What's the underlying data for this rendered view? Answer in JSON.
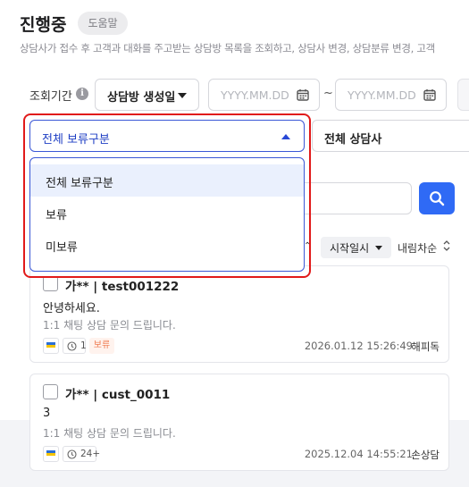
{
  "page": {
    "title": "진행중",
    "help_label": "도움말",
    "description": "상담사가 접수 후 고객과 대화를 주고받는 상담방 목록을 조회하고, 상담사 변경, 상담분류 변경, 고객"
  },
  "filters": {
    "period_label": "조회기간",
    "date_type": "상담방 생성일",
    "start_placeholder": "YYYY.MM.DD",
    "range_separator": "~",
    "end_placeholder": "YYYY.MM.DD",
    "hold_select": "전체 보류구분",
    "counselor_select": "전체 상담사"
  },
  "hold_dropdown": {
    "options": [
      "전체 보류구분",
      "보류",
      "미보류"
    ],
    "selected_index": 0
  },
  "sort": {
    "field": "시작일시",
    "order": "내림차순"
  },
  "cards": [
    {
      "title": "가** | test001222",
      "message": "안녕하세요.",
      "subtitle": "1:1 채팅 상담 문의 드립니다.",
      "timer": "1",
      "hold_badge": "보류",
      "datetime": "2026.01.12 15:26:49",
      "agent": "해피독"
    },
    {
      "title": "가** | cust_0011",
      "message": "3",
      "subtitle": "1:1 채팅 상담 문의 드립니다.",
      "timer": "24+",
      "hold_badge": "",
      "datetime": "2025.12.04 14:55:21",
      "agent": "손상담"
    }
  ],
  "colors": {
    "primary": "#2f6af5",
    "focus_border": "#3a57d6",
    "highlight_frame": "#e11a1a",
    "hold_badge_text": "#ef7a4f",
    "hold_badge_bg": "#fff3ee"
  },
  "icons": {
    "info": "info-circle-icon",
    "calendar": "calendar-icon",
    "search": "search-icon",
    "timer": "clock-icon",
    "channel": "kakao-channel-icon",
    "sort_order": "up-down-icon"
  }
}
